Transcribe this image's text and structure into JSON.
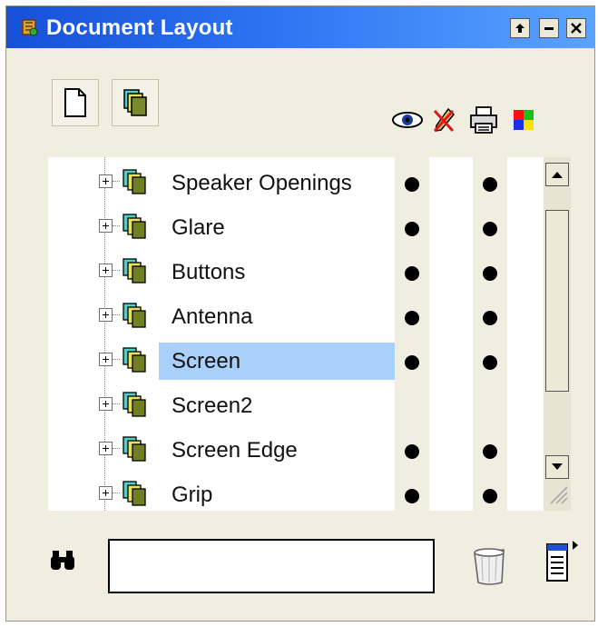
{
  "window": {
    "title": "Document Layout",
    "controls": [
      "restore",
      "minimize",
      "close"
    ]
  },
  "toolbar": {
    "buttons": [
      {
        "icon": "new-page-icon",
        "tooltip": ""
      },
      {
        "icon": "duplicate-pages-icon",
        "tooltip": ""
      }
    ],
    "column_icons": [
      "eye-icon",
      "no-edit-pencil-icon",
      "printer-icon",
      "color-squares-icon"
    ]
  },
  "layers": [
    {
      "name": "Speaker Openings",
      "visible": true,
      "printable": true,
      "selected": false
    },
    {
      "name": "Glare",
      "visible": true,
      "printable": true,
      "selected": false
    },
    {
      "name": "Buttons",
      "visible": true,
      "printable": true,
      "selected": false
    },
    {
      "name": "Antenna",
      "visible": true,
      "printable": true,
      "selected": false
    },
    {
      "name": "Screen",
      "visible": true,
      "printable": true,
      "selected": true
    },
    {
      "name": "Screen2",
      "visible": false,
      "printable": false,
      "selected": false
    },
    {
      "name": "Screen Edge",
      "visible": true,
      "printable": true,
      "selected": false
    },
    {
      "name": "Grip",
      "visible": true,
      "printable": true,
      "selected": false
    }
  ],
  "search": {
    "value": "",
    "placeholder": ""
  },
  "colors": {
    "title_start": "#1750d9",
    "title_end": "#5aa3ff",
    "panel_bg": "#f0eee0",
    "selection": "#a8d0f8",
    "list_bg": "#ffffff"
  }
}
